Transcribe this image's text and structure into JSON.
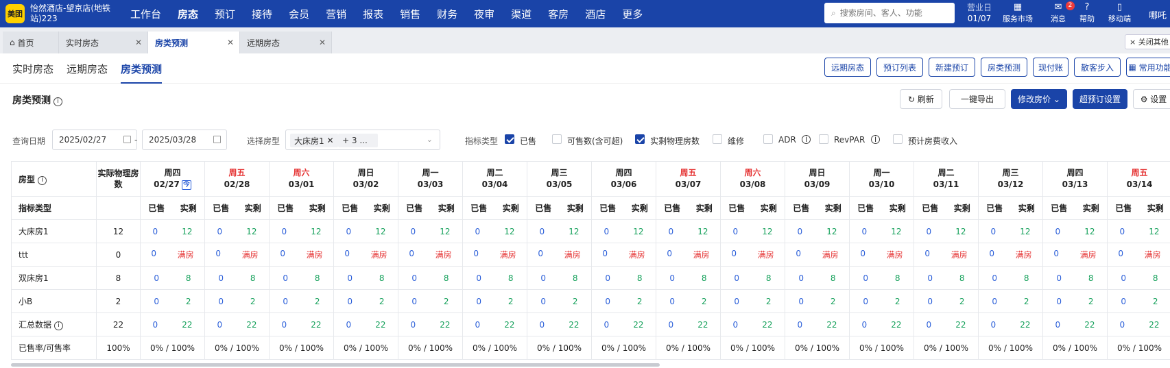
{
  "app": {
    "logo": "美团",
    "hotel": "怡然酒店-望京店(地铁站)223"
  },
  "nav": [
    "工作台",
    "房态",
    "预订",
    "接待",
    "会员",
    "营销",
    "报表",
    "销售",
    "财务",
    "夜审",
    "渠道",
    "客房",
    "酒店",
    "更多"
  ],
  "search": {
    "placeholder": "搜索房间、客人、功能"
  },
  "bizdate": {
    "label": "营业日",
    "value": "01/07"
  },
  "tools": {
    "market": "服务市场",
    "msg": "消息",
    "msg_badge": "2",
    "help": "帮助",
    "mobile": "移动端",
    "user": "哪吒"
  },
  "tabs": {
    "home": "首页",
    "t1": "实时房态",
    "t2": "房类预测",
    "t3": "远期房态",
    "close_others": "× 关闭其他"
  },
  "subtabs": [
    "实时房态",
    "远期房态",
    "房类预测"
  ],
  "quick": [
    "远期房态",
    "预订列表",
    "新建预订",
    "房类预测",
    "现付账",
    "散客步入",
    "常用功能"
  ],
  "section": {
    "title": "房类预测",
    "refresh": "刷新",
    "export": "一键导出",
    "modify": "修改房价",
    "super": "超预订设置",
    "settings": "设置"
  },
  "filters": {
    "date_label": "查询日期",
    "date_from": "2025/02/27",
    "date_sep": "-",
    "date_to": "2025/03/28",
    "room_label": "选择房型",
    "chip1": "大床房1",
    "chip2": "+ 3 ...",
    "metric_label": "指标类型",
    "metrics": [
      {
        "label": "已售",
        "on": true
      },
      {
        "label": "可售数(含可超)",
        "on": false
      },
      {
        "label": "实剩物理房数",
        "on": true
      },
      {
        "label": "维修",
        "on": false
      },
      {
        "label": "ADR",
        "on": false
      },
      {
        "label": "RevPAR",
        "on": false
      },
      {
        "label": "预计房费收入",
        "on": false
      }
    ]
  },
  "table": {
    "h_room": "房型",
    "h_phys": "实际物理房数",
    "h_metric": "指标类型",
    "sold": "已售",
    "remain": "实剩",
    "dates": [
      {
        "w": "周四",
        "d": "02/27",
        "we": false
      },
      {
        "w": "周五",
        "d": "02/28",
        "we": true
      },
      {
        "w": "周六",
        "d": "03/01",
        "we": true
      },
      {
        "w": "周日",
        "d": "03/02",
        "we": false
      },
      {
        "w": "周一",
        "d": "03/03",
        "we": false
      },
      {
        "w": "周二",
        "d": "03/04",
        "we": false
      },
      {
        "w": "周三",
        "d": "03/05",
        "we": false
      },
      {
        "w": "周四",
        "d": "03/06",
        "we": false
      },
      {
        "w": "周五",
        "d": "03/07",
        "we": true
      },
      {
        "w": "周六",
        "d": "03/08",
        "we": true
      },
      {
        "w": "周日",
        "d": "03/09",
        "we": false
      },
      {
        "w": "周一",
        "d": "03/10",
        "we": false
      },
      {
        "w": "周二",
        "d": "03/11",
        "we": false
      },
      {
        "w": "周三",
        "d": "03/12",
        "we": false
      },
      {
        "w": "周四",
        "d": "03/13",
        "we": false
      },
      {
        "w": "周五",
        "d": "03/14",
        "we": true
      }
    ],
    "today_icon": "今",
    "rows": [
      {
        "name": "大床房1",
        "phys": "12",
        "sold": "0",
        "remain": "12",
        "full": false
      },
      {
        "name": "ttt",
        "phys": "0",
        "sold": "0",
        "remain": "满房",
        "full": true
      },
      {
        "name": "双床房1",
        "phys": "8",
        "sold": "0",
        "remain": "8",
        "full": false
      },
      {
        "name": "小B",
        "phys": "2",
        "sold": "0",
        "remain": "2",
        "full": false
      },
      {
        "name": "汇总数据",
        "phys": "22",
        "sold": "0",
        "remain": "22",
        "full": false,
        "info": true
      }
    ],
    "rate_label": "已售率/可售率",
    "rate_total": "100%",
    "rate_value": "0% / 100%"
  },
  "colors": {
    "brand": "#1a44a8",
    "weekend": "#e53333",
    "sold": "#2b5fd9",
    "remain": "#14a05a"
  }
}
